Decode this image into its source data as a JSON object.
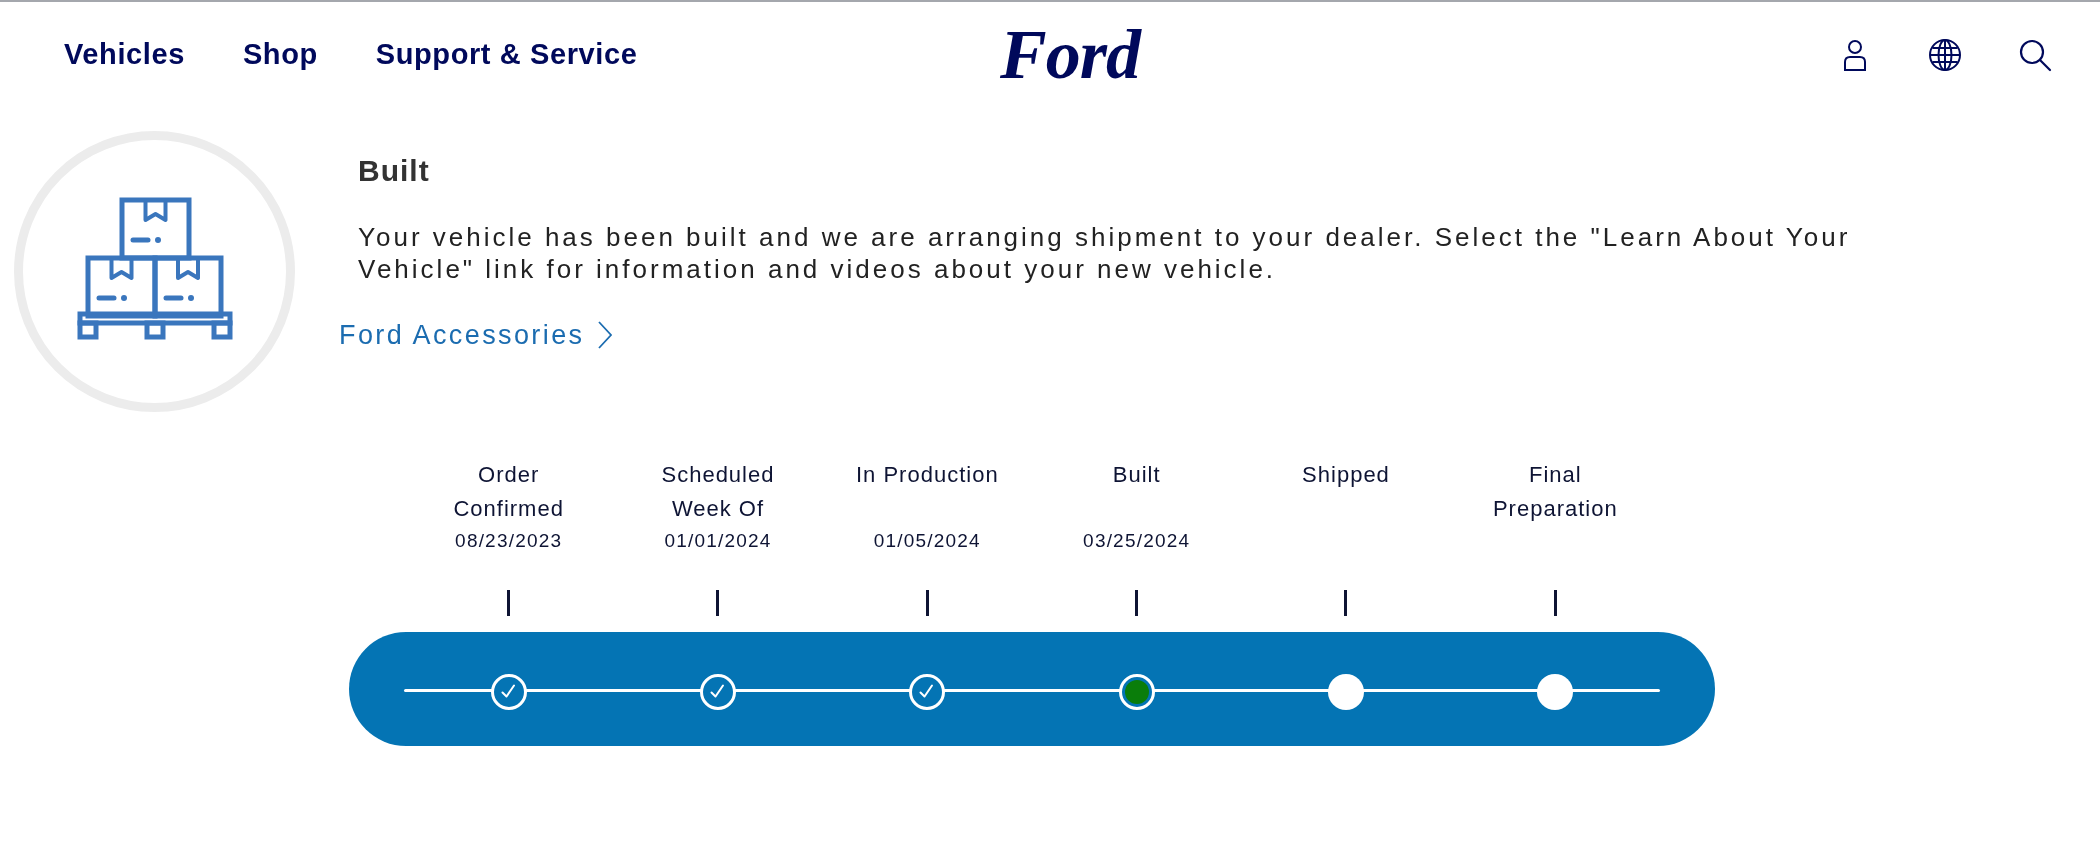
{
  "header": {
    "nav": [
      "Vehicles",
      "Shop",
      "Support & Service"
    ],
    "logo": "Ford"
  },
  "status": {
    "title": "Built",
    "description": "Your vehicle has been built and we are arranging shipment to your dealer. Select the \"Learn About Your Vehicle\" link for information and videos about your new vehicle.",
    "link": "Ford Accessories"
  },
  "timeline": {
    "steps": [
      {
        "label": "Order Confirmed",
        "date": "08/23/2023",
        "completed": true,
        "current": false
      },
      {
        "label": "Scheduled Week Of",
        "date": "01/01/2024",
        "completed": true,
        "current": false
      },
      {
        "label": "In Production",
        "date": "01/05/2024",
        "completed": true,
        "current": false
      },
      {
        "label": "Built",
        "date": "03/25/2024",
        "completed": false,
        "current": true
      },
      {
        "label": "Shipped",
        "completed": false,
        "current": false
      },
      {
        "label": "Final Preparation",
        "completed": false,
        "current": false
      }
    ]
  }
}
